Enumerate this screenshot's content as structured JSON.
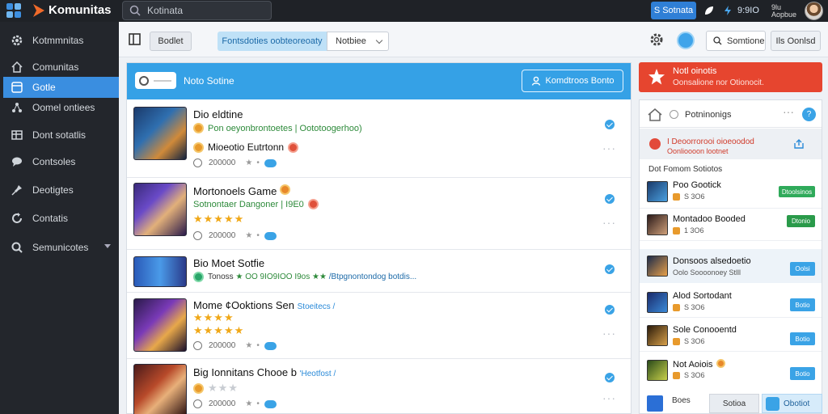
{
  "app": {
    "name": "Komunitas"
  },
  "topbar": {
    "search_value": "Kotinata",
    "status_label": "S Sotnata",
    "time": "9:9IO",
    "user_line1": "9lu",
    "user_line2": "Aopbue"
  },
  "sidebar": {
    "items": [
      {
        "label": "Kotmmnitas",
        "icon": "gear-icon"
      },
      {
        "label": "Comunitas",
        "icon": "home-icon"
      },
      {
        "label": "Gotle",
        "icon": "grid-icon",
        "active": true
      },
      {
        "label": "Oomel ontiees",
        "icon": "network-icon"
      },
      {
        "label": "Dont sotatlis",
        "icon": "table-icon"
      },
      {
        "label": "Contsoles",
        "icon": "chat-icon"
      },
      {
        "label": "Deotigtes",
        "icon": "pin-icon"
      },
      {
        "label": "Contatis",
        "icon": "refresh-icon"
      },
      {
        "label": "Semunicotes",
        "icon": "search-icon",
        "has_dropdown": true
      }
    ]
  },
  "toolbar": {
    "grid_button": "Bodlet",
    "filter_pill": "Fontsdoties oobteoreoaty",
    "select_value": "Notbiee",
    "search_button": "Somtione",
    "ghost_button": "Ils Oonlsd"
  },
  "main": {
    "header_title": "Noto Sotine",
    "header_button": "Komdtroos Bonto",
    "games": [
      {
        "title": "Dio eldtine",
        "line1": "Pon oeyonbrontoetes | Oototoogerhoo)",
        "line2": "Mioeotio Eutrtonn",
        "meta": "200000"
      },
      {
        "title": "Mortonoels Game",
        "line1": "Sotnontaer Dangoner | I9E0",
        "rating": "★★★★★",
        "meta": "200000"
      },
      {
        "title": "Bio Moet Sotfie",
        "line1": "Tonoss",
        "line1b": "★ OO 9IO9IOO I9os ★★",
        "line1c": "/Btpgnontondog botdis...",
        "meta": ""
      },
      {
        "title": "Mome ¢Ooktions Sen",
        "title_suffix": "Stoeitecs /",
        "rating": "★★★★",
        "rating2": "★★★★★",
        "meta": "200000"
      },
      {
        "title": "Big Ionnitans Chooe b",
        "title_suffix": "'Heotfost /",
        "rating": "★★★",
        "meta": "200000"
      }
    ]
  },
  "notice": {
    "title": "Notl oinotis",
    "subtitle": "Oonsalione nor Otionocit."
  },
  "right": {
    "header_title": "Potninonigs",
    "help": "?",
    "alert_line1": "I Deoorrorooi oioeoodod",
    "alert_line2": "Oonlioooon lootnet",
    "section": "Dot   Fomom Sotiotos",
    "items": [
      {
        "title": "Poo Gootick",
        "sub": "S 3O6",
        "button": "Dtoolsinos",
        "button_color": "#2faa5a"
      },
      {
        "title": "Montadoo Booded",
        "sub": "1 3O6",
        "button": "Dtonio",
        "button_color": "#2a9a4a"
      },
      {
        "title": "Donsoos alsedoetio",
        "sub": "Oolo Soooonoey Stlll",
        "button": "Oolsi",
        "button_color": "#3aa3e6"
      },
      {
        "title": "Alod Sortodant",
        "sub": "S 3O6",
        "button": "Botio",
        "button_color": "#3aa3e6"
      },
      {
        "title": "Sole Conooentd",
        "sub": "S 3O6",
        "button": "Botio",
        "button_color": "#3aa3e6"
      },
      {
        "title": "Not Aoiois",
        "sub": "S 3O6",
        "button": "Botio",
        "button_color": "#3aa3e6"
      }
    ]
  },
  "footer": {
    "text": "Boes",
    "button1": "Sotioa",
    "button2": "Obotiot"
  }
}
